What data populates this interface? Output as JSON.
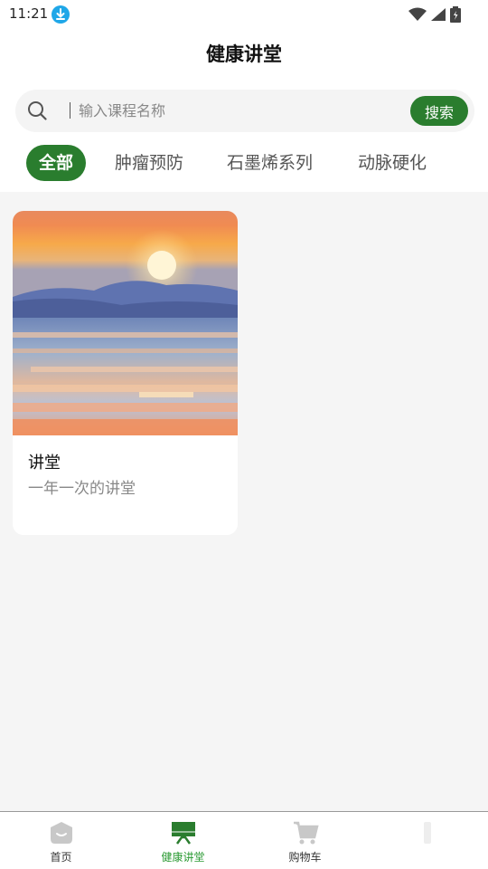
{
  "status_bar": {
    "time": "11:21"
  },
  "header": {
    "title": "健康讲堂"
  },
  "search": {
    "placeholder": "输入课程名称",
    "button_label": "搜索"
  },
  "tabs": [
    {
      "label": "全部",
      "active": true
    },
    {
      "label": "肿瘤预防",
      "active": false
    },
    {
      "label": "石墨烯系列",
      "active": false
    },
    {
      "label": "动脉硬化",
      "active": false
    }
  ],
  "courses": [
    {
      "title": "讲堂",
      "subtitle": "一年一次的讲堂",
      "image": "sunset-over-sea-painting"
    }
  ],
  "bottom_nav": [
    {
      "label": "首页",
      "icon": "home-icon",
      "active": false
    },
    {
      "label": "健康讲堂",
      "icon": "lecture-board-icon",
      "active": true
    },
    {
      "label": "购物车",
      "icon": "cart-icon",
      "active": false
    },
    {
      "label": "",
      "icon": "profile-icon",
      "active": false
    }
  ],
  "colors": {
    "accent": "#2a7d2e",
    "nav_active": "#2a9a32",
    "background": "#f5f5f5"
  }
}
